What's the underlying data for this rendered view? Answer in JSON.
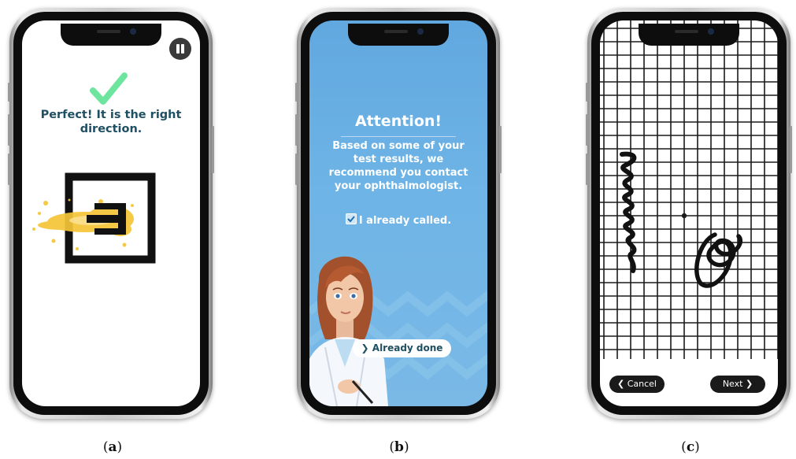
{
  "phone_a": {
    "message": "Perfect! It is the right direction.",
    "colors": {
      "check": "#6ee59f",
      "text": "#1f4f62",
      "splash": "#f5c537"
    },
    "icons": [
      "pause-icon",
      "checkmark-icon",
      "arrow-right-icon"
    ]
  },
  "phone_b": {
    "title": "Attention!",
    "body": "Based on some of your test results, we recommend you contact your ophthalmologist.",
    "checkbox_label": "I already called.",
    "checkbox_checked": true,
    "button_label": "Already done",
    "colors": {
      "background": "#6eb4e6",
      "button_text": "#1f4f62"
    },
    "icons": [
      "checkbox-icon",
      "chevron-right-icon",
      "doctor-avatar"
    ]
  },
  "phone_c": {
    "cancel_label": "Cancel",
    "next_label": "Next",
    "icons": [
      "chevron-left-icon",
      "chevron-right-icon"
    ]
  },
  "captions": {
    "a": "a",
    "b": "b",
    "c": "c"
  }
}
